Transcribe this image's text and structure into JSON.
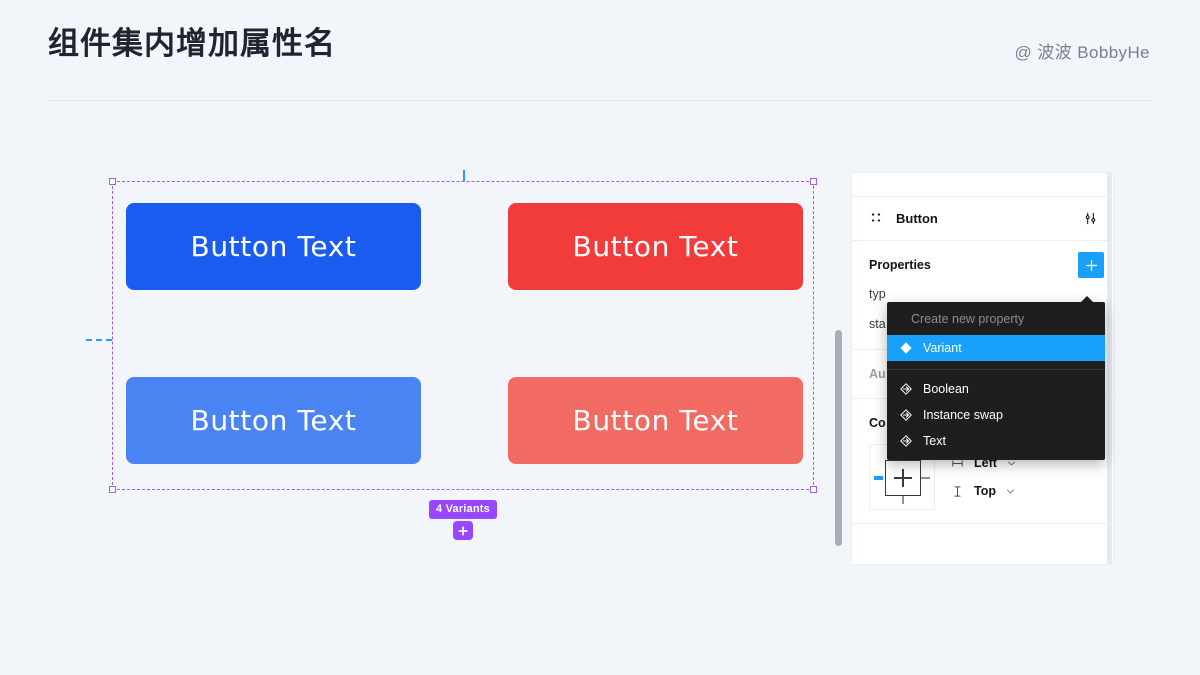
{
  "header": {
    "title": "组件集内增加属性名",
    "byline": "@ 波波 BobbyHe"
  },
  "canvas": {
    "buttons": [
      {
        "label": "Button Text",
        "color": "#1a5cf0",
        "name": "variant-primary-default"
      },
      {
        "label": "Button Text",
        "color": "#f23b3b",
        "name": "variant-danger-default"
      },
      {
        "label": "Button Text",
        "color": "#4a83f2",
        "name": "variant-primary-hover"
      },
      {
        "label": "Button Text",
        "color": "#f26b63",
        "name": "variant-danger-hover"
      }
    ],
    "variant_badge": "4 Variants",
    "selection_color": "#a259ff",
    "guide_color": "#1aa3f2"
  },
  "panel": {
    "component_name": "Button",
    "properties": {
      "title": "Properties",
      "add_label": "+",
      "rows": [
        "typ",
        "sta"
      ]
    },
    "auto_layout": {
      "title": "Au"
    },
    "constraints": {
      "title": "Co",
      "horizontal": "Left",
      "vertical": "Top"
    }
  },
  "menu": {
    "header": "Create new property",
    "items": [
      {
        "label": "Variant",
        "icon": "diamond-filled-icon",
        "active": true
      },
      {
        "label": "Boolean",
        "icon": "property-arrow-icon",
        "active": false
      },
      {
        "label": "Instance swap",
        "icon": "property-arrow-icon",
        "active": false
      },
      {
        "label": "Text",
        "icon": "property-arrow-icon",
        "active": false
      }
    ],
    "accent": "#18a0fb"
  }
}
